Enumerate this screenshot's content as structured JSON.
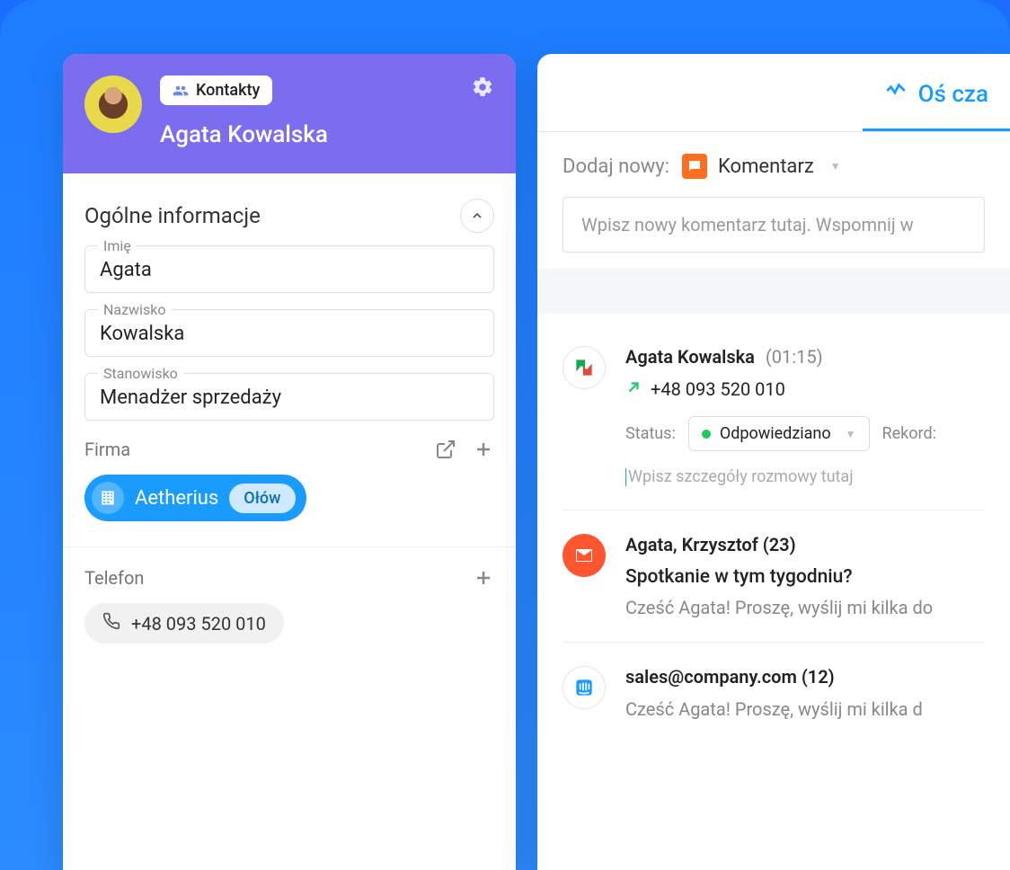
{
  "header": {
    "badge_label": "Kontakty",
    "name": "Agata Kowalska"
  },
  "general": {
    "title": "Ogólne informacje",
    "first_name_label": "Imię",
    "first_name_value": "Agata",
    "last_name_label": "Nazwisko",
    "last_name_value": "Kowalska",
    "position_label": "Stanowisko",
    "position_value": "Menadżer sprzedaży"
  },
  "company": {
    "label": "Firma",
    "name": "Aetherius",
    "tag": "Ołów"
  },
  "phone": {
    "label": "Telefon",
    "value": "+48 093 520 010"
  },
  "timeline_tab": {
    "label": "Oś cza"
  },
  "add_new": {
    "label": "Dodaj nowy:",
    "type": "Komentarz",
    "placeholder": "Wpisz nowy komentarz tutaj. Wspomnij w"
  },
  "activity1": {
    "name": "Agata Kowalska",
    "time": "(01:15)",
    "phone": "+48 093 520 010",
    "status_label": "Status:",
    "status_value": "Odpowiedziano",
    "record_label": "Rekord:",
    "details_placeholder": "Wpisz szczegóły rozmowy tutaj"
  },
  "activity2": {
    "title": "Agata, Krzysztof (23)",
    "subject": "Spotkanie w tym tygodniu?",
    "preview": "Cześć Agata! Proszę, wyślij mi kilka do"
  },
  "activity3": {
    "title": "sales@company.com (12)",
    "preview": "Cześć Agata! Proszę, wyślij mi kilka d"
  }
}
